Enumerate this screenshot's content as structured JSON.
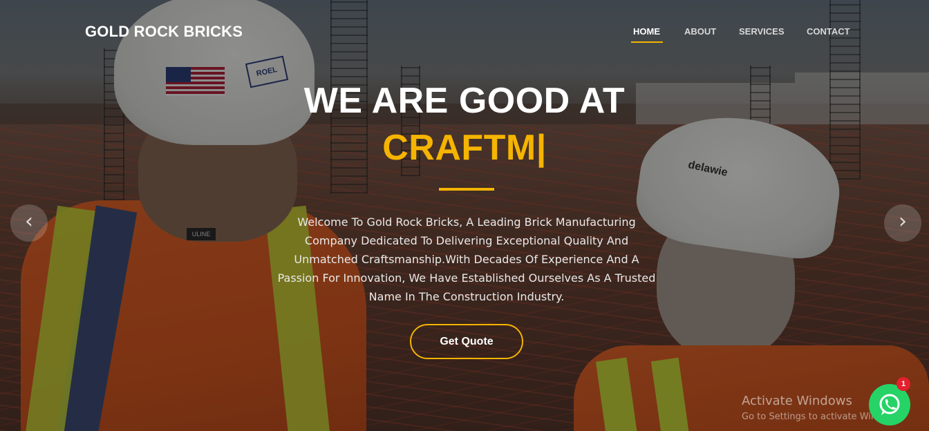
{
  "header": {
    "brand": "GOLD ROCK BRICKS",
    "nav": [
      {
        "label": "HOME",
        "active": true
      },
      {
        "label": "ABOUT",
        "active": false
      },
      {
        "label": "SERVICES",
        "active": false
      },
      {
        "label": "CONTACT",
        "active": false
      }
    ]
  },
  "hero": {
    "headline": "WE ARE GOOD AT",
    "typed_text": "CRAFTM|",
    "description": "Welcome To Gold Rock Bricks, A Leading Brick Manufacturing Company Dedicated To Delivering Exceptional Quality And Unmatched Craftsmanship.With Decades Of Experience And A Passion For Innovation, We Have Established Ourselves As A Trusted Name In The Construction Industry.",
    "cta_label": "Get Quote",
    "prev_icon": "chevron-left-icon",
    "next_icon": "chevron-right-icon",
    "helmet_text_left": "ROEL",
    "helmet_text_right": "delawie",
    "vest_label": "ULINE"
  },
  "colors": {
    "accent": "#f5b400",
    "whatsapp": "#25d366",
    "badge": "#e5202e"
  },
  "watermark": {
    "title": "Activate Windows",
    "subtitle": "Go to Settings to activate Windows."
  },
  "whatsapp": {
    "icon": "whatsapp-icon",
    "badge_count": "1"
  }
}
